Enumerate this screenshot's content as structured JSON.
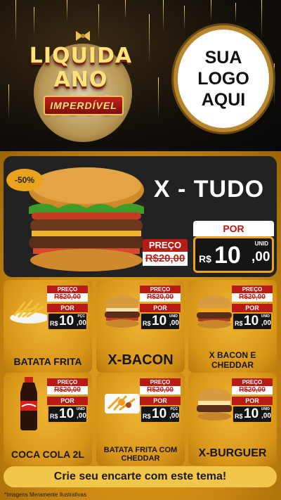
{
  "header": {
    "badge_line1": "LIQUIDA",
    "badge_line2": "ANO NOVO",
    "badge_ribbon": "IMPERDÍVEL",
    "logo_line1": "SUA",
    "logo_line2": "LOGO",
    "logo_line3": "AQUI"
  },
  "hero": {
    "discount": "-50%",
    "title": "X - TUDO",
    "preco_label": "PREÇO",
    "old_price": "R$20,00",
    "por_label": "POR",
    "currency": "R$",
    "price_int": "10",
    "price_dec": ",00",
    "unit": "UNID"
  },
  "products": [
    {
      "name": "BATATA FRITA",
      "preco_label": "PREÇO",
      "old_price": "R$20,00",
      "por_label": "POR",
      "currency": "R$",
      "price_int": "10",
      "price_dec": ",00",
      "unit": "PÇC"
    },
    {
      "name": "X-BACON",
      "preco_label": "PREÇO",
      "old_price": "R$20,00",
      "por_label": "POR",
      "currency": "R$",
      "price_int": "10",
      "price_dec": ",00",
      "unit": "UNID"
    },
    {
      "name": "X BACON E CHEDDAR",
      "preco_label": "PREÇO",
      "old_price": "R$20,00",
      "por_label": "POR",
      "currency": "R$",
      "price_int": "10",
      "price_dec": ",00",
      "unit": "UNID"
    },
    {
      "name": "COCA COLA 2L",
      "preco_label": "PREÇO",
      "old_price": "R$20,00",
      "por_label": "POR",
      "currency": "R$",
      "price_int": "10",
      "price_dec": ",00",
      "unit": "UNID"
    },
    {
      "name": "BATATA FRITA COM CHEDDAR",
      "preco_label": "PREÇO",
      "old_price": "R$20,00",
      "por_label": "POR",
      "currency": "R$",
      "price_int": "10",
      "price_dec": ",00",
      "unit": "PÇC"
    },
    {
      "name": "X-BURGUER",
      "preco_label": "PREÇO",
      "old_price": "R$20,00",
      "por_label": "POR",
      "currency": "R$",
      "price_int": "10",
      "price_dec": ",00",
      "unit": "UNID"
    }
  ],
  "cta": "Crie seu encarte com este tema!",
  "footnote": "*Imagens Meramente Ilustrativas",
  "icons": [
    "gift-bow-icon",
    "burger-image",
    "fries-image",
    "soda-bottle-image",
    "cheddar-fries-image"
  ],
  "colors": {
    "accent_gold": "#e9a31c",
    "price_red": "#b81a14",
    "dark_panel": "#222222"
  }
}
